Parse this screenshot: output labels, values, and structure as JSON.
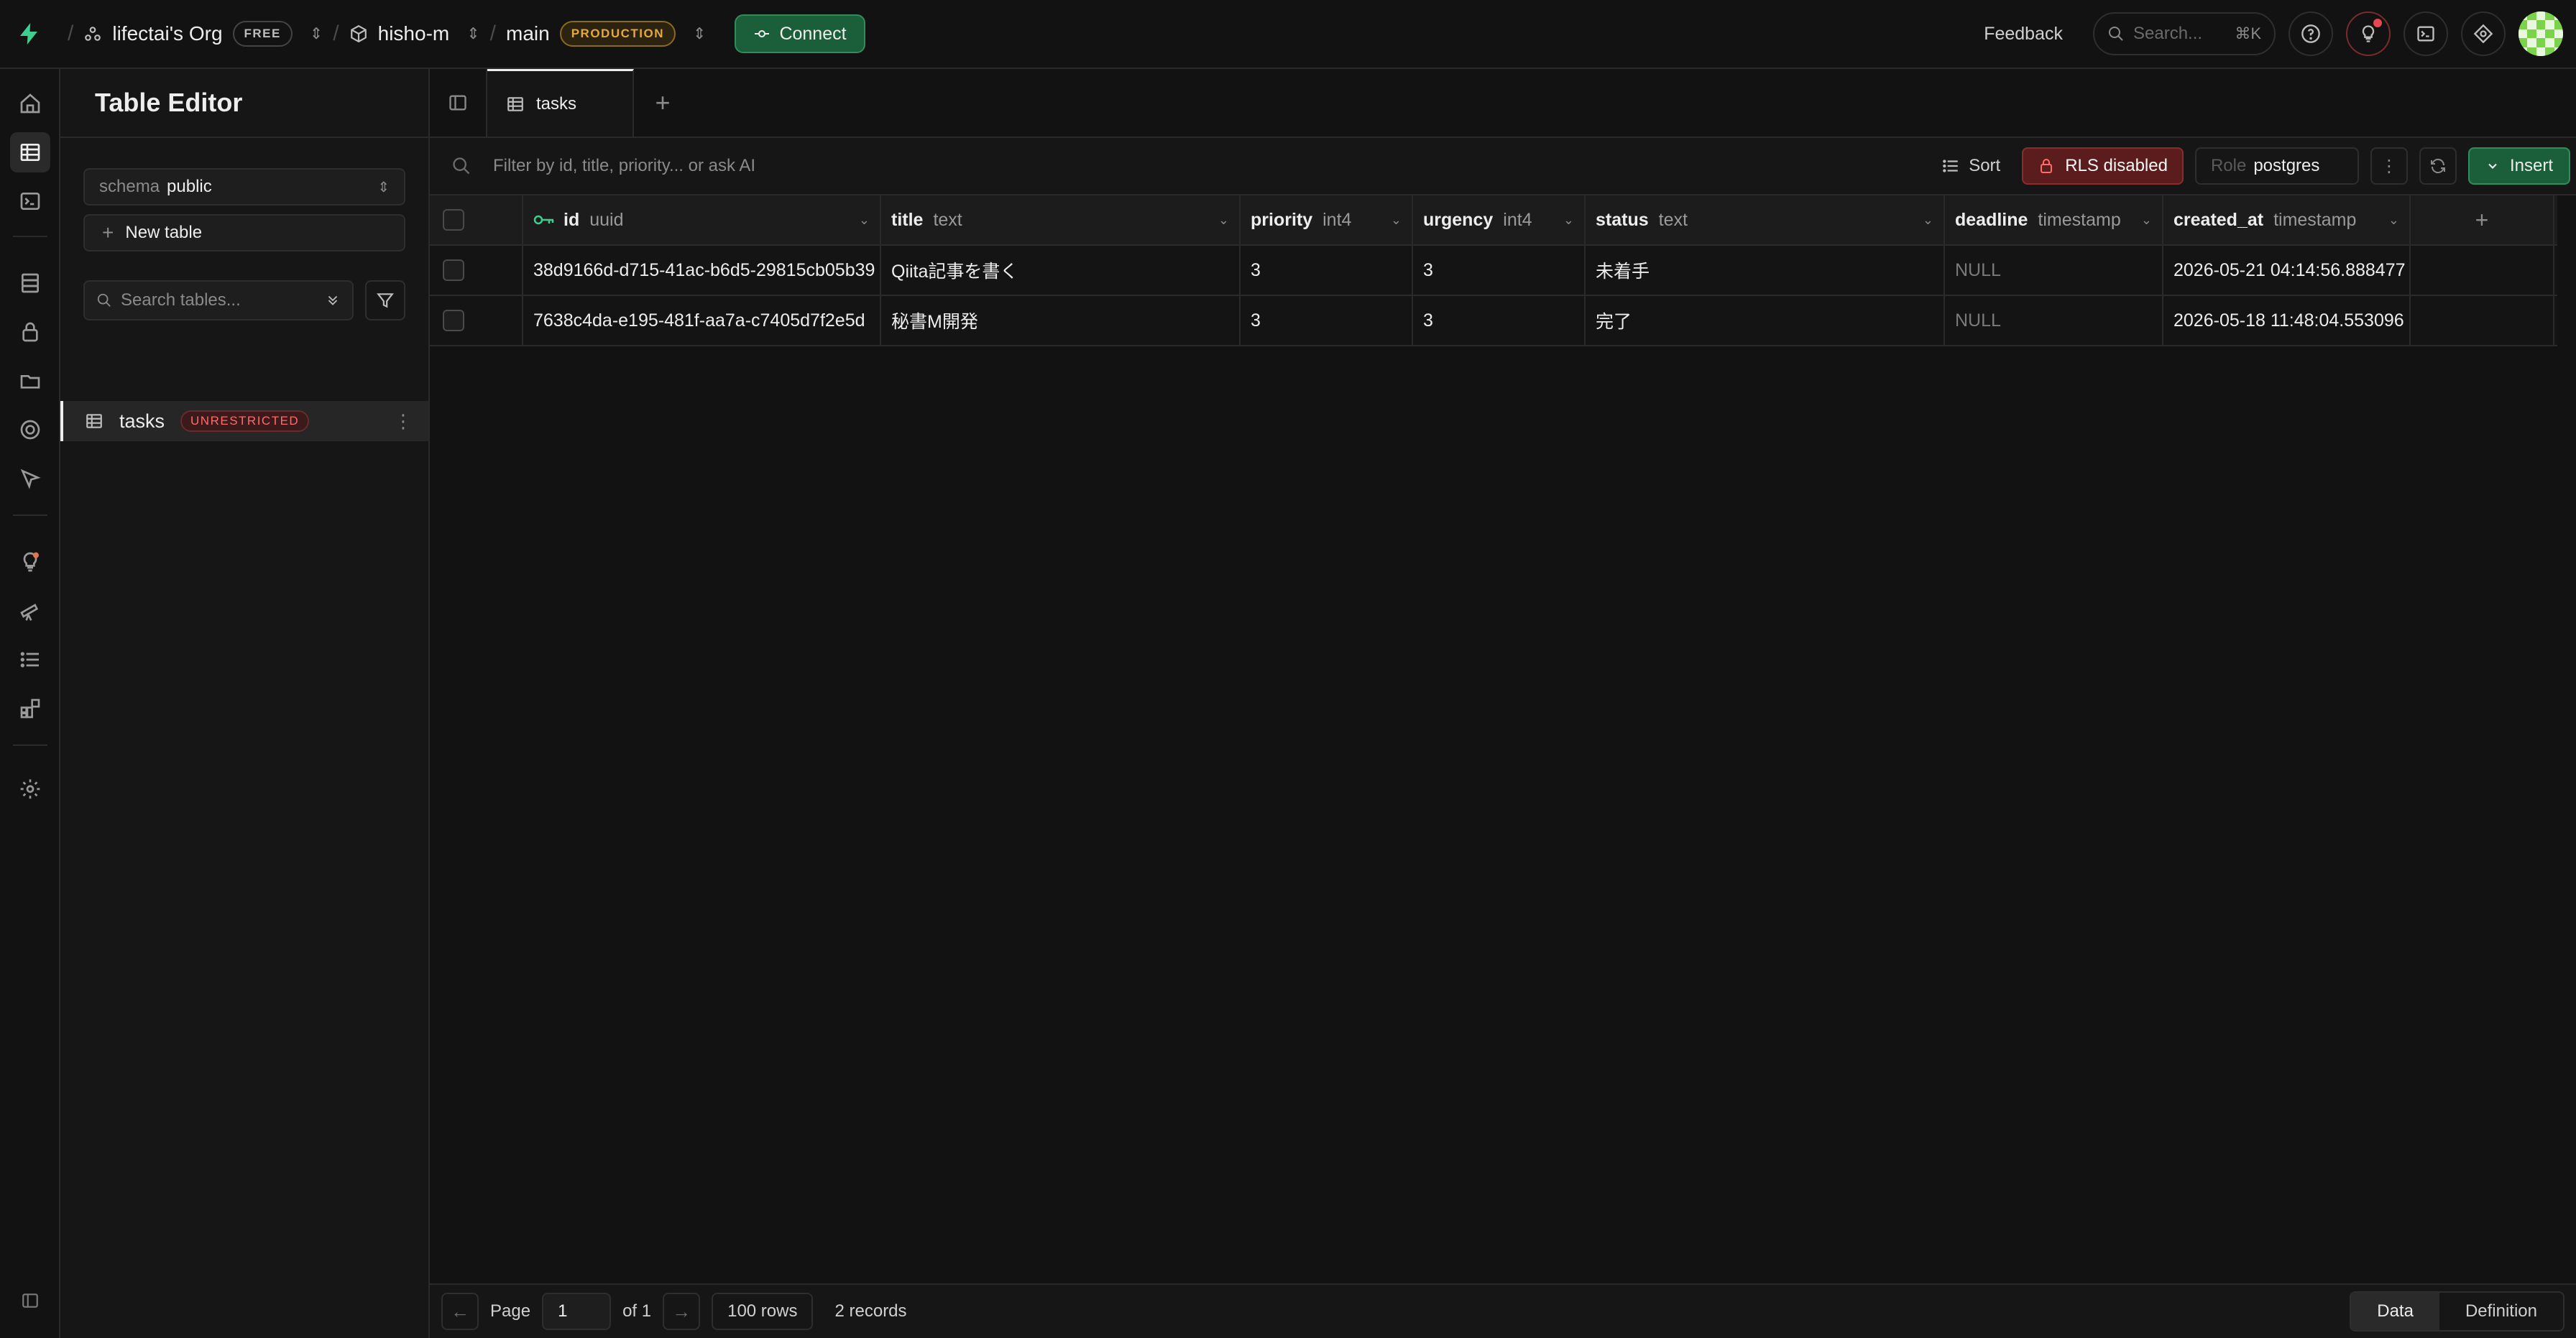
{
  "topbar": {
    "org": "lifectai's Org",
    "org_badge": "FREE",
    "project": "hisho-m",
    "branch": "main",
    "branch_badge": "PRODUCTION",
    "connect_label": "Connect",
    "feedback_label": "Feedback",
    "search_placeholder": "Search...",
    "search_shortcut": "⌘K"
  },
  "sidebar": {
    "title": "Table Editor",
    "schema_label": "schema",
    "schema_value": "public",
    "new_table_label": "New table",
    "search_placeholder": "Search tables...",
    "tables": [
      {
        "name": "tasks",
        "badge": "UNRESTRICTED"
      }
    ]
  },
  "tabs": [
    {
      "label": "tasks"
    }
  ],
  "toolbar": {
    "filter_placeholder": "Filter by id, title, priority... or ask AI",
    "sort_label": "Sort",
    "rls_label": "RLS disabled",
    "role_label": "Role",
    "role_value": "postgres",
    "insert_label": "Insert"
  },
  "grid": {
    "columns": [
      {
        "name": "id",
        "type": "uuid"
      },
      {
        "name": "title",
        "type": "text"
      },
      {
        "name": "priority",
        "type": "int4"
      },
      {
        "name": "urgency",
        "type": "int4"
      },
      {
        "name": "status",
        "type": "text"
      },
      {
        "name": "deadline",
        "type": "timestamp"
      },
      {
        "name": "created_at",
        "type": "timestamp"
      }
    ],
    "rows": [
      [
        "38d9166d-d715-41ac-b6d5-29815cb05b39",
        "Qiita記事を書く",
        "3",
        "3",
        "未着手",
        "NULL",
        "2026-05-21 04:14:56.888477"
      ],
      [
        "7638c4da-e195-481f-aa7a-c7405d7f2e5d",
        "秘書M開発",
        "3",
        "3",
        "完了",
        "NULL",
        "2026-05-18 11:48:04.553096"
      ]
    ]
  },
  "footer": {
    "page_label": "Page",
    "page_value": "1",
    "of_label": "of 1",
    "rows_label": "100 rows",
    "records_label": "2 records",
    "view_data": "Data",
    "view_definition": "Definition"
  },
  "colors": {
    "accent_green": "#3ecf8e",
    "danger": "#e5484d",
    "warning": "#e5a93b"
  }
}
